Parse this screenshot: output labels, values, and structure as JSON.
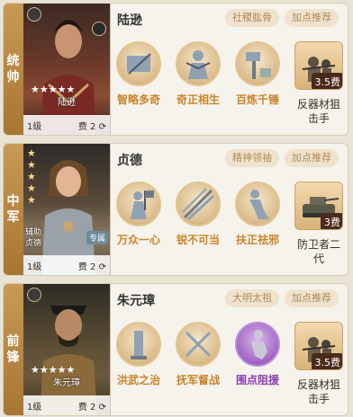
{
  "cards": [
    {
      "position_label": [
        "统",
        "帅"
      ],
      "name": "陆逊",
      "tags": [
        "社稷肱骨",
        "加点推荐"
      ],
      "portrait": {
        "name": "陆逊",
        "level": "1级",
        "cost": "费 2",
        "star_count": 5
      },
      "skills": [
        {
          "label": "智略多奇",
          "icon": "scroll-icon",
          "color": "#c9842a"
        },
        {
          "label": "奇正相生",
          "icon": "figure-icon",
          "color": "#c9842a"
        },
        {
          "label": "百炼千锤",
          "icon": "hammer-icon",
          "color": "#c9842a"
        }
      ],
      "troop": {
        "fee": "3.5费",
        "label": "反器材狙击手",
        "icon": "sniper-icon"
      }
    },
    {
      "position_label": [
        "中",
        "军"
      ],
      "name": "贞德",
      "tags": [
        "精神领袖",
        "加点推荐"
      ],
      "portrait": {
        "name": "贞德",
        "sub1": "辅助",
        "badge": "专属",
        "level": "1级",
        "cost": "费 2",
        "star_count": 5
      },
      "skills": [
        {
          "label": "万众一心",
          "icon": "banner-icon",
          "color": "#c9842a"
        },
        {
          "label": "锐不可当",
          "icon": "spear-icon",
          "color": "#c9842a"
        },
        {
          "label": "扶正祛邪",
          "icon": "kneel-icon",
          "color": "#c9842a"
        }
      ],
      "troop": {
        "fee": "3费",
        "label": "防卫者二代",
        "icon": "tank-icon"
      }
    },
    {
      "position_label": [
        "前",
        "锋"
      ],
      "name": "朱元璋",
      "tags": [
        "大明太祖",
        "加点推荐"
      ],
      "portrait": {
        "name": "朱元璋",
        "level": "1级",
        "cost": "费 2",
        "star_count": 5
      },
      "skills": [
        {
          "label": "洪武之治",
          "icon": "pillar-icon",
          "color": "#c9842a"
        },
        {
          "label": "抚军督战",
          "icon": "crossed-swords-icon",
          "color": "#c9842a"
        },
        {
          "label": "围点阻援",
          "icon": "runner-icon",
          "color": "#8b3fb2"
        }
      ],
      "troop": {
        "fee": "3.5费",
        "label": "反器材狙击手",
        "icon": "sniper-icon"
      }
    }
  ]
}
